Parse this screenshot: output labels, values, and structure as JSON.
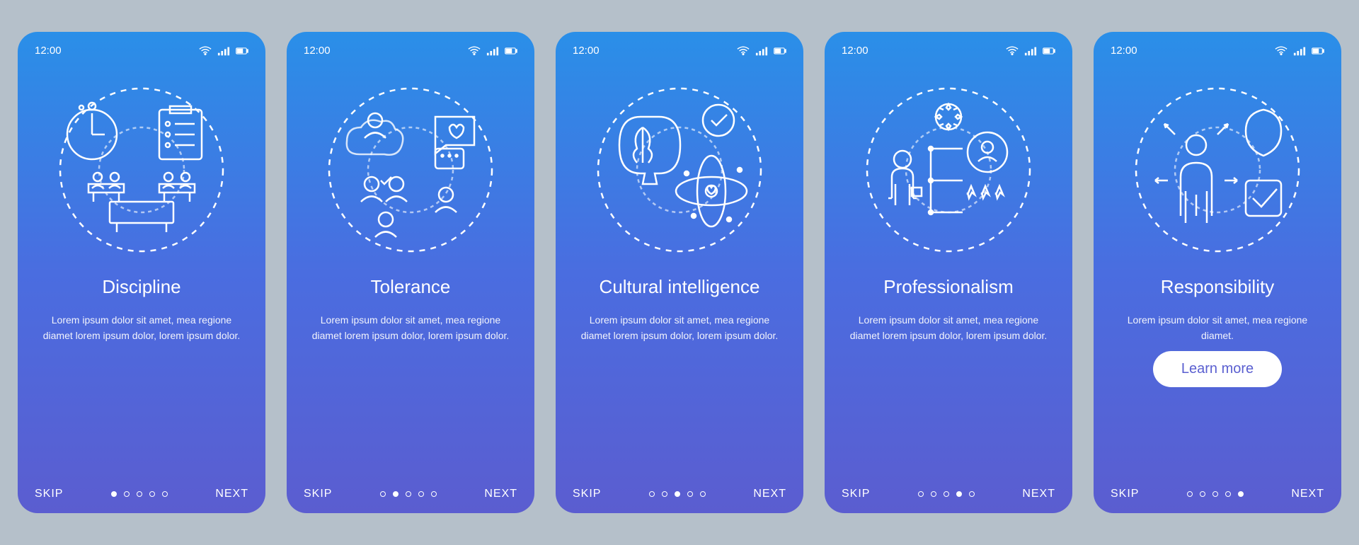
{
  "status": {
    "time": "12:00"
  },
  "nav": {
    "skip": "SKIP",
    "next": "NEXT"
  },
  "cta": "Learn more",
  "screens": [
    {
      "title": "Discipline",
      "body": "Lorem ipsum dolor sit amet, mea regione diamet lorem ipsum dolor, lorem ipsum dolor.",
      "activeDot": 0,
      "hasCta": false,
      "icon": "discipline-icon"
    },
    {
      "title": "Tolerance",
      "body": "Lorem ipsum dolor sit amet, mea regione diamet lorem ipsum dolor, lorem ipsum dolor.",
      "activeDot": 1,
      "hasCta": false,
      "icon": "tolerance-icon"
    },
    {
      "title": "Cultural intelligence",
      "body": "Lorem ipsum dolor sit amet, mea regione diamet lorem ipsum dolor, lorem ipsum dolor.",
      "activeDot": 2,
      "hasCta": false,
      "icon": "cultural-intelligence-icon"
    },
    {
      "title": "Professionalism",
      "body": "Lorem ipsum dolor sit amet, mea regione diamet lorem ipsum dolor, lorem ipsum dolor.",
      "activeDot": 3,
      "hasCta": false,
      "icon": "professionalism-icon"
    },
    {
      "title": "Responsibility",
      "body": "Lorem ipsum dolor sit amet, mea regione diamet.",
      "activeDot": 4,
      "hasCta": true,
      "icon": "responsibility-icon"
    }
  ]
}
